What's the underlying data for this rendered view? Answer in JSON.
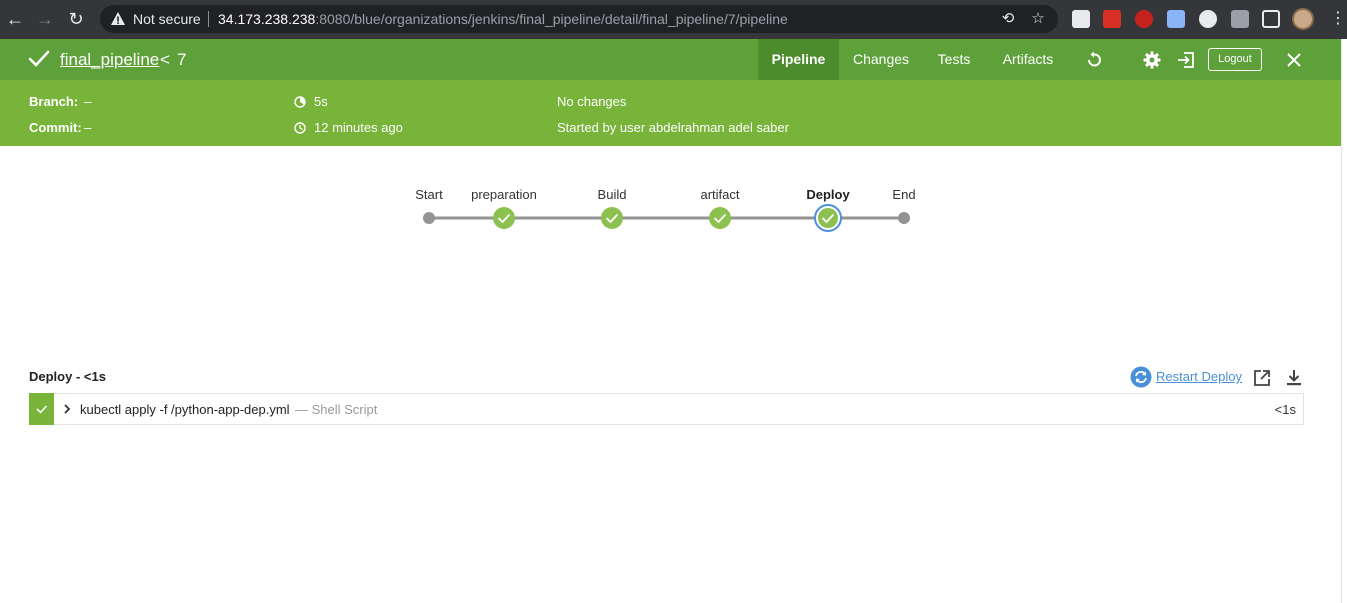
{
  "browser": {
    "security_label": "Not secure",
    "url_host": "34.173.238.238",
    "url_rest": ":8080/blue/organizations/jenkins/final_pipeline/detail/final_pipeline/7/pipeline"
  },
  "header": {
    "pipeline_name": "final_pipeline",
    "separator": "<",
    "run_number": "7",
    "tabs": [
      {
        "label": "Pipeline",
        "active": true
      },
      {
        "label": "Changes",
        "active": false
      },
      {
        "label": "Tests",
        "active": false
      },
      {
        "label": "Artifacts",
        "active": false
      }
    ],
    "logout_label": "Logout"
  },
  "summary": {
    "branch_label": "Branch:",
    "branch_value": "–",
    "commit_label": "Commit:",
    "commit_value": "–",
    "duration": "5s",
    "time_ago": "12 minutes ago",
    "changes": "No changes",
    "started_by": "Started by user abdelrahman adel saber"
  },
  "graph": {
    "stages": [
      {
        "name": "Start",
        "type": "terminal"
      },
      {
        "name": "preparation",
        "type": "success"
      },
      {
        "name": "Build",
        "type": "success"
      },
      {
        "name": "artifact",
        "type": "success"
      },
      {
        "name": "Deploy",
        "type": "success",
        "selected": true
      },
      {
        "name": "End",
        "type": "terminal"
      }
    ]
  },
  "steps": {
    "section_title": "Deploy - <1s",
    "restart_label": "Restart Deploy",
    "items": [
      {
        "command": "kubectl apply -f /python-app-dep.yml",
        "kind": "— Shell Script",
        "duration": "<1s",
        "status": "success"
      }
    ]
  },
  "colors": {
    "header_green": "#5ea03a",
    "subheader_green": "#78b33a",
    "success_node": "#8cc04f",
    "selected_ring": "#4a90d9",
    "link_blue": "#4a90d9"
  }
}
